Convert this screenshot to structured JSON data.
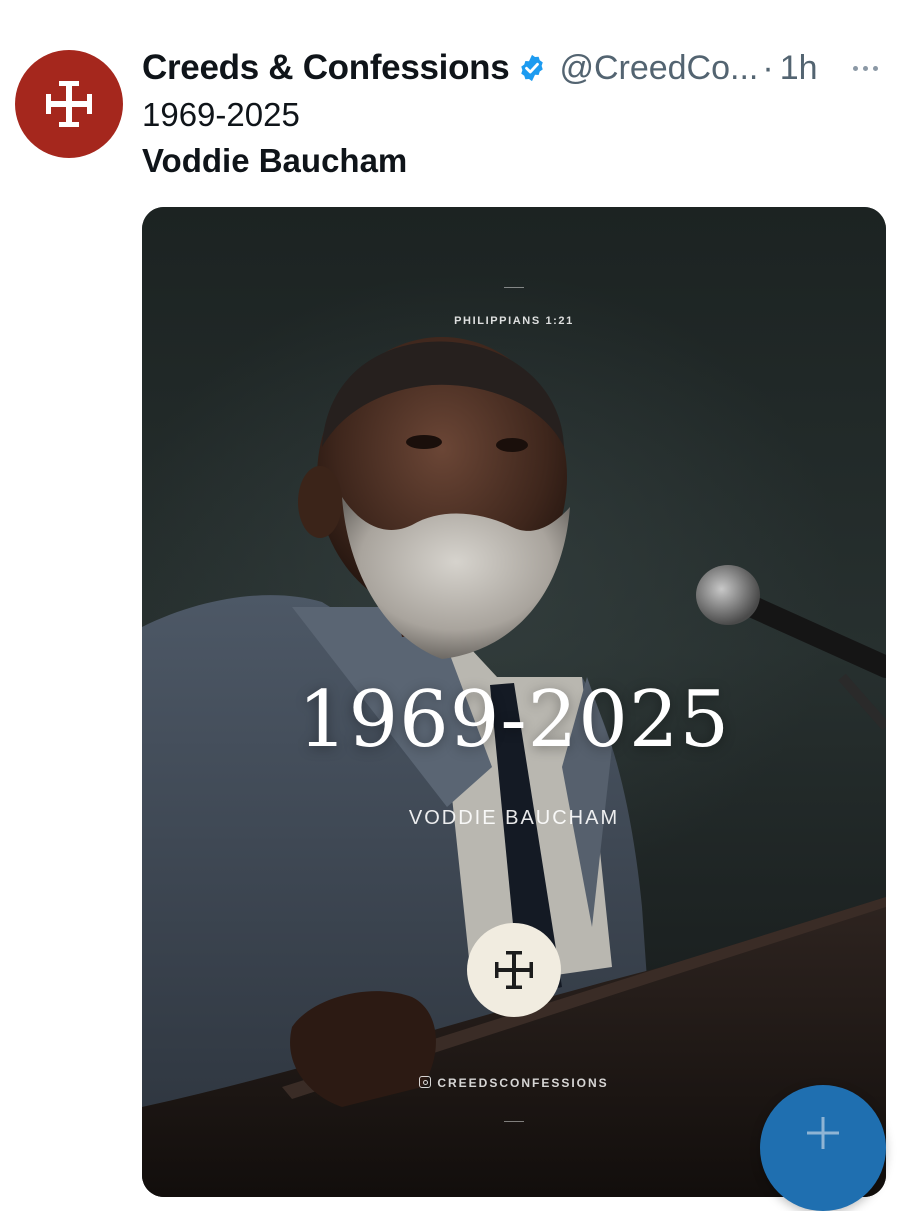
{
  "tweet": {
    "display_name": "Creeds & Confessions",
    "handle": "@CreedCo...",
    "separator": "·",
    "time": "1h",
    "text_line1": "1969-2025",
    "text_line2": "Voddie Baucham"
  },
  "media": {
    "verse": "PHILIPPIANS 1:21",
    "years": "1969-2025",
    "name": "VODDIE BAUCHAM",
    "instagram_handle": "CREEDSCONFESSIONS"
  },
  "colors": {
    "avatar_bg": "#a5271d",
    "verified_badge": "#1d9bf0",
    "fab_bg": "#1f6fb0",
    "text_primary": "#0f1419",
    "text_secondary": "#536471"
  },
  "icons": {
    "avatar": "cross-potent-icon",
    "verified": "verified-badge-icon",
    "more": "more-horizontal-icon",
    "fab": "plus-icon",
    "instagram": "instagram-icon"
  }
}
